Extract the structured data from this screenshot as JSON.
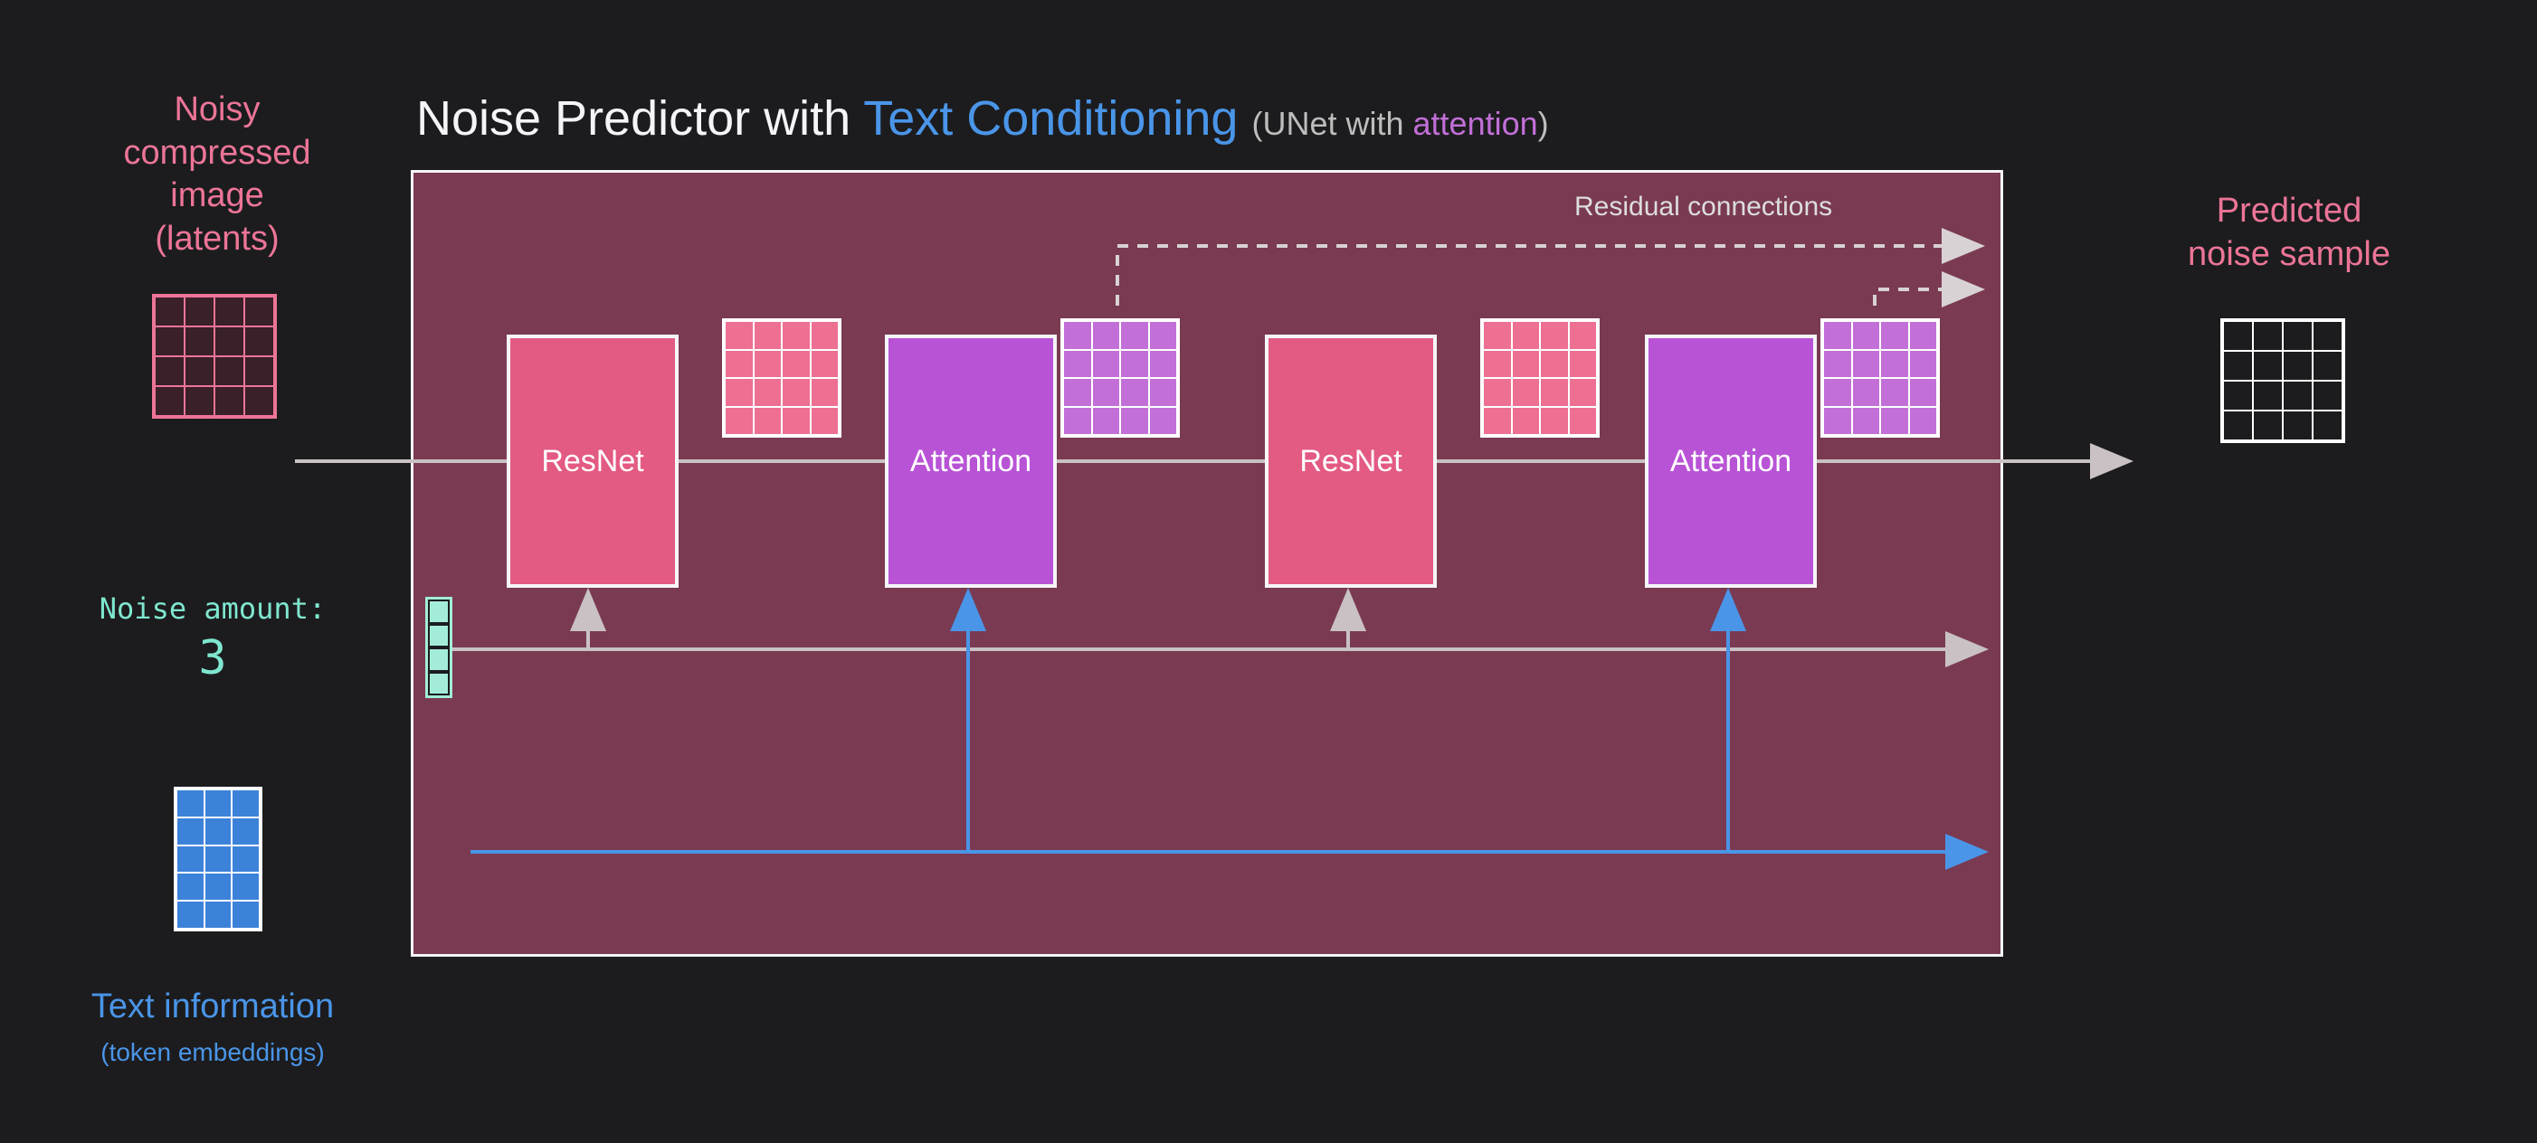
{
  "left": {
    "noisy_label_l1": "Noisy",
    "noisy_label_l2": "compressed",
    "noisy_label_l3": "image",
    "noisy_label_l4": "(latents)",
    "noise_amount_label": "Noise amount:",
    "noise_amount_value": "3",
    "text_info_label": "Text information",
    "text_info_sub": "(token embeddings)"
  },
  "title": {
    "prefix": "Noise Predictor with ",
    "text_conditioning": "Text Conditioning",
    "sub_prefix": " (UNet with ",
    "attention_word": "attention",
    "sub_suffix": ")"
  },
  "blocks": {
    "resnet": "ResNet",
    "attention": "Attention"
  },
  "residual_label": "Residual connections",
  "right": {
    "predicted_l1": "Predicted",
    "predicted_l2": "noise sample"
  },
  "colors": {
    "pink": "#ec7597",
    "purple": "#c26fd8",
    "blue": "#4a95e8",
    "teal": "#7fe7cf",
    "box_bg": "#7a3a52"
  }
}
